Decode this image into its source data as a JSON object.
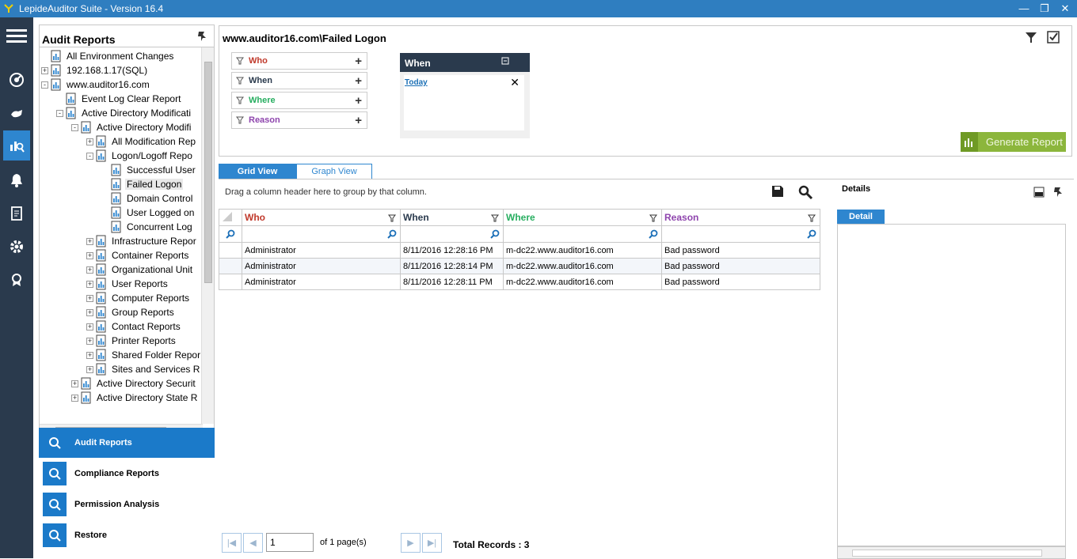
{
  "window": {
    "title": "LepideAuditor Suite - Version 16.4",
    "minimize": "—",
    "restore": "❐",
    "close": "✕"
  },
  "rail": {
    "icons": [
      "menu-icon",
      "radar-icon",
      "hand-icon",
      "audit-reports-icon",
      "bell-icon",
      "report-icon",
      "settings-icon",
      "license-icon"
    ]
  },
  "left": {
    "header": "Audit Reports",
    "tree": [
      {
        "label": "All Environment Changes",
        "level": 0,
        "exp": "",
        "sel": false
      },
      {
        "label": "192.168.1.17(SQL)",
        "level": 0,
        "exp": "+",
        "sel": false
      },
      {
        "label": "www.auditor16.com",
        "level": 0,
        "exp": "−",
        "sel": false
      },
      {
        "label": "Event Log Clear Report",
        "level": 1,
        "exp": "",
        "sel": false
      },
      {
        "label": "Active Directory Modificati",
        "level": 1,
        "exp": "−",
        "sel": false
      },
      {
        "label": "Active Directory Modifi",
        "level": 2,
        "exp": "−",
        "sel": false
      },
      {
        "label": "All Modification Rep",
        "level": 3,
        "exp": "+",
        "sel": false
      },
      {
        "label": "Logon/Logoff Repo",
        "level": 3,
        "exp": "−",
        "sel": false
      },
      {
        "label": "Successful User",
        "level": 4,
        "exp": "",
        "sel": false
      },
      {
        "label": "Failed Logon",
        "level": 4,
        "exp": "",
        "sel": true
      },
      {
        "label": "Domain Control",
        "level": 4,
        "exp": "",
        "sel": false
      },
      {
        "label": "User Logged on",
        "level": 4,
        "exp": "",
        "sel": false
      },
      {
        "label": "Concurrent Log",
        "level": 4,
        "exp": "",
        "sel": false
      },
      {
        "label": "Infrastructure Repor",
        "level": 3,
        "exp": "+",
        "sel": false
      },
      {
        "label": "Container Reports",
        "level": 3,
        "exp": "+",
        "sel": false
      },
      {
        "label": "Organizational Unit",
        "level": 3,
        "exp": "+",
        "sel": false
      },
      {
        "label": "User Reports",
        "level": 3,
        "exp": "+",
        "sel": false
      },
      {
        "label": "Computer Reports",
        "level": 3,
        "exp": "+",
        "sel": false
      },
      {
        "label": "Group Reports",
        "level": 3,
        "exp": "+",
        "sel": false
      },
      {
        "label": "Contact Reports",
        "level": 3,
        "exp": "+",
        "sel": false
      },
      {
        "label": "Printer Reports",
        "level": 3,
        "exp": "+",
        "sel": false
      },
      {
        "label": "Shared Folder Repor",
        "level": 3,
        "exp": "+",
        "sel": false
      },
      {
        "label": "Sites and Services R",
        "level": 3,
        "exp": "+",
        "sel": false
      },
      {
        "label": "Active Directory Securit",
        "level": 2,
        "exp": "+",
        "sel": false
      },
      {
        "label": "Active Directory State R",
        "level": 2,
        "exp": "+",
        "sel": false
      }
    ],
    "nav": [
      {
        "label": "Audit Reports",
        "active": true
      },
      {
        "label": "Compliance Reports",
        "active": false
      },
      {
        "label": "Permission Analysis",
        "active": false
      },
      {
        "label": "Restore",
        "active": false
      }
    ]
  },
  "criteria": {
    "title": "www.auditor16.com\\Failed Logon",
    "filters": [
      {
        "label": "Who",
        "color": "#c0392b"
      },
      {
        "label": "When",
        "color": "#2a3a4d"
      },
      {
        "label": "Where",
        "color": "#27ae60"
      },
      {
        "label": "Reason",
        "color": "#8e44ad"
      }
    ],
    "when_box": {
      "header": "When",
      "value": "Today"
    },
    "generate": "Generate Report"
  },
  "tabs": {
    "grid": "Grid View",
    "graph": "Graph View"
  },
  "grid": {
    "hint": "Drag a column header here to group by that column.",
    "columns": [
      {
        "label": "Who",
        "color": "#c0392b"
      },
      {
        "label": "When",
        "color": "#2a3a4d"
      },
      {
        "label": "Where",
        "color": "#27ae60"
      },
      {
        "label": "Reason",
        "color": "#8e44ad"
      }
    ],
    "rows": [
      [
        "Administrator",
        "8/11/2016 12:28:16 PM",
        "m-dc22.www.auditor16.com",
        "Bad password"
      ],
      [
        "Administrator",
        "8/11/2016 12:28:14 PM",
        "m-dc22.www.auditor16.com",
        "Bad password"
      ],
      [
        "Administrator",
        "8/11/2016 12:28:11 PM",
        "m-dc22.www.auditor16.com",
        "Bad password"
      ]
    ]
  },
  "pager": {
    "page": "1",
    "of_label": "of 1 page(s)",
    "total": "Total Records : 3"
  },
  "details": {
    "title": "Details",
    "tab": "Detail"
  }
}
